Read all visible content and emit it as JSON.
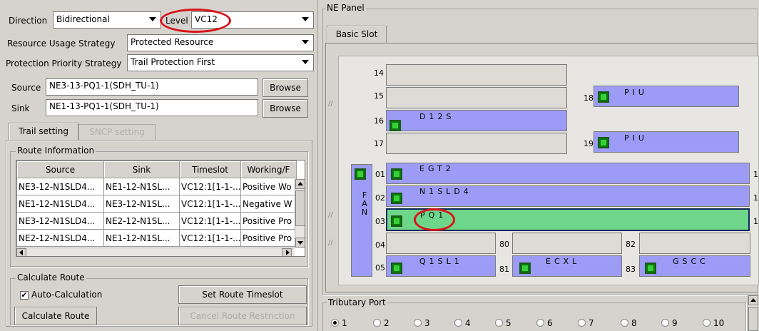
{
  "left": {
    "direction_label": "Direction",
    "direction_value": "Bidirectional",
    "level_label": "Level",
    "level_value": "VC12",
    "resource_label": "Resource Usage Strategy",
    "resource_value": "Protected Resource",
    "priority_label": "Protection Priority Strategy",
    "priority_value": "Trail Protection First",
    "source_label": "Source",
    "source_value": "NE3-13-PQ1-1(SDH_TU-1)",
    "sink_label": "Sink",
    "sink_value": "NE1-13-PQ1-1(SDH_TU-1)",
    "browse_label": "Browse",
    "tabs": [
      "Trail setting",
      "SNCP setting"
    ],
    "route_info_title": "Route Information",
    "columns": [
      "Source",
      "Sink",
      "Timeslot",
      "Working/F"
    ],
    "rows": [
      [
        "NE3-12-N1SLD4...",
        "NE1-12-N1SL...",
        "VC12:1[1-1-...",
        "Positive Wo"
      ],
      [
        "NE1-12-N1SLD4...",
        "NE3-12-N1SL...",
        "VC12:1[1-1-...",
        "Negative W"
      ],
      [
        "NE3-12-N1SLD4...",
        "NE2-12-N1SL...",
        "VC12:1[1-1-...",
        "Positive Pro"
      ],
      [
        "NE2-12-N1SLD4...",
        "NE1-12-N1SL...",
        "VC12:1[1-1-...",
        "Positive Pro"
      ]
    ],
    "calc_title": "Calculate Route",
    "auto_calc_label": "Auto-Calculation",
    "set_timeslot_label": "Set Route Timeslot",
    "calc_route_label": "Calculate Route",
    "cancel_restriction_label": "Cancel Route Restriction"
  },
  "ne_panel": {
    "title": "NE Panel",
    "tab": "Basic Slot",
    "fan_label": "F A N",
    "slots": {
      "s14": {
        "num": "14",
        "name": ""
      },
      "s15": {
        "num": "15",
        "name": ""
      },
      "s16": {
        "num": "16",
        "name": "D12S"
      },
      "s17": {
        "num": "17",
        "name": ""
      },
      "s18": {
        "num": "18",
        "name": "PIU"
      },
      "s19": {
        "num": "19",
        "name": "PIU"
      },
      "s01": {
        "num": "01",
        "name": "EGT2",
        "right": "1"
      },
      "s02": {
        "num": "02",
        "name": "N1SLD4",
        "right": "1"
      },
      "s03": {
        "num": "03",
        "name": "PQ1",
        "right": "1"
      },
      "s04": {
        "num": "04",
        "name": ""
      },
      "s05": {
        "num": "05",
        "name": "Q1SL1"
      },
      "s80": {
        "num": "80",
        "name": ""
      },
      "s81": {
        "num": "81",
        "name": "ECXL"
      },
      "s82": {
        "num": "82",
        "name": ""
      },
      "s83": {
        "num": "83",
        "name": "GSCC"
      }
    },
    "tributary_title": "Tributary Port",
    "ports": [
      "1",
      "2",
      "3",
      "4",
      "5",
      "6",
      "7",
      "8",
      "9",
      "10"
    ],
    "selected_port": "1"
  }
}
